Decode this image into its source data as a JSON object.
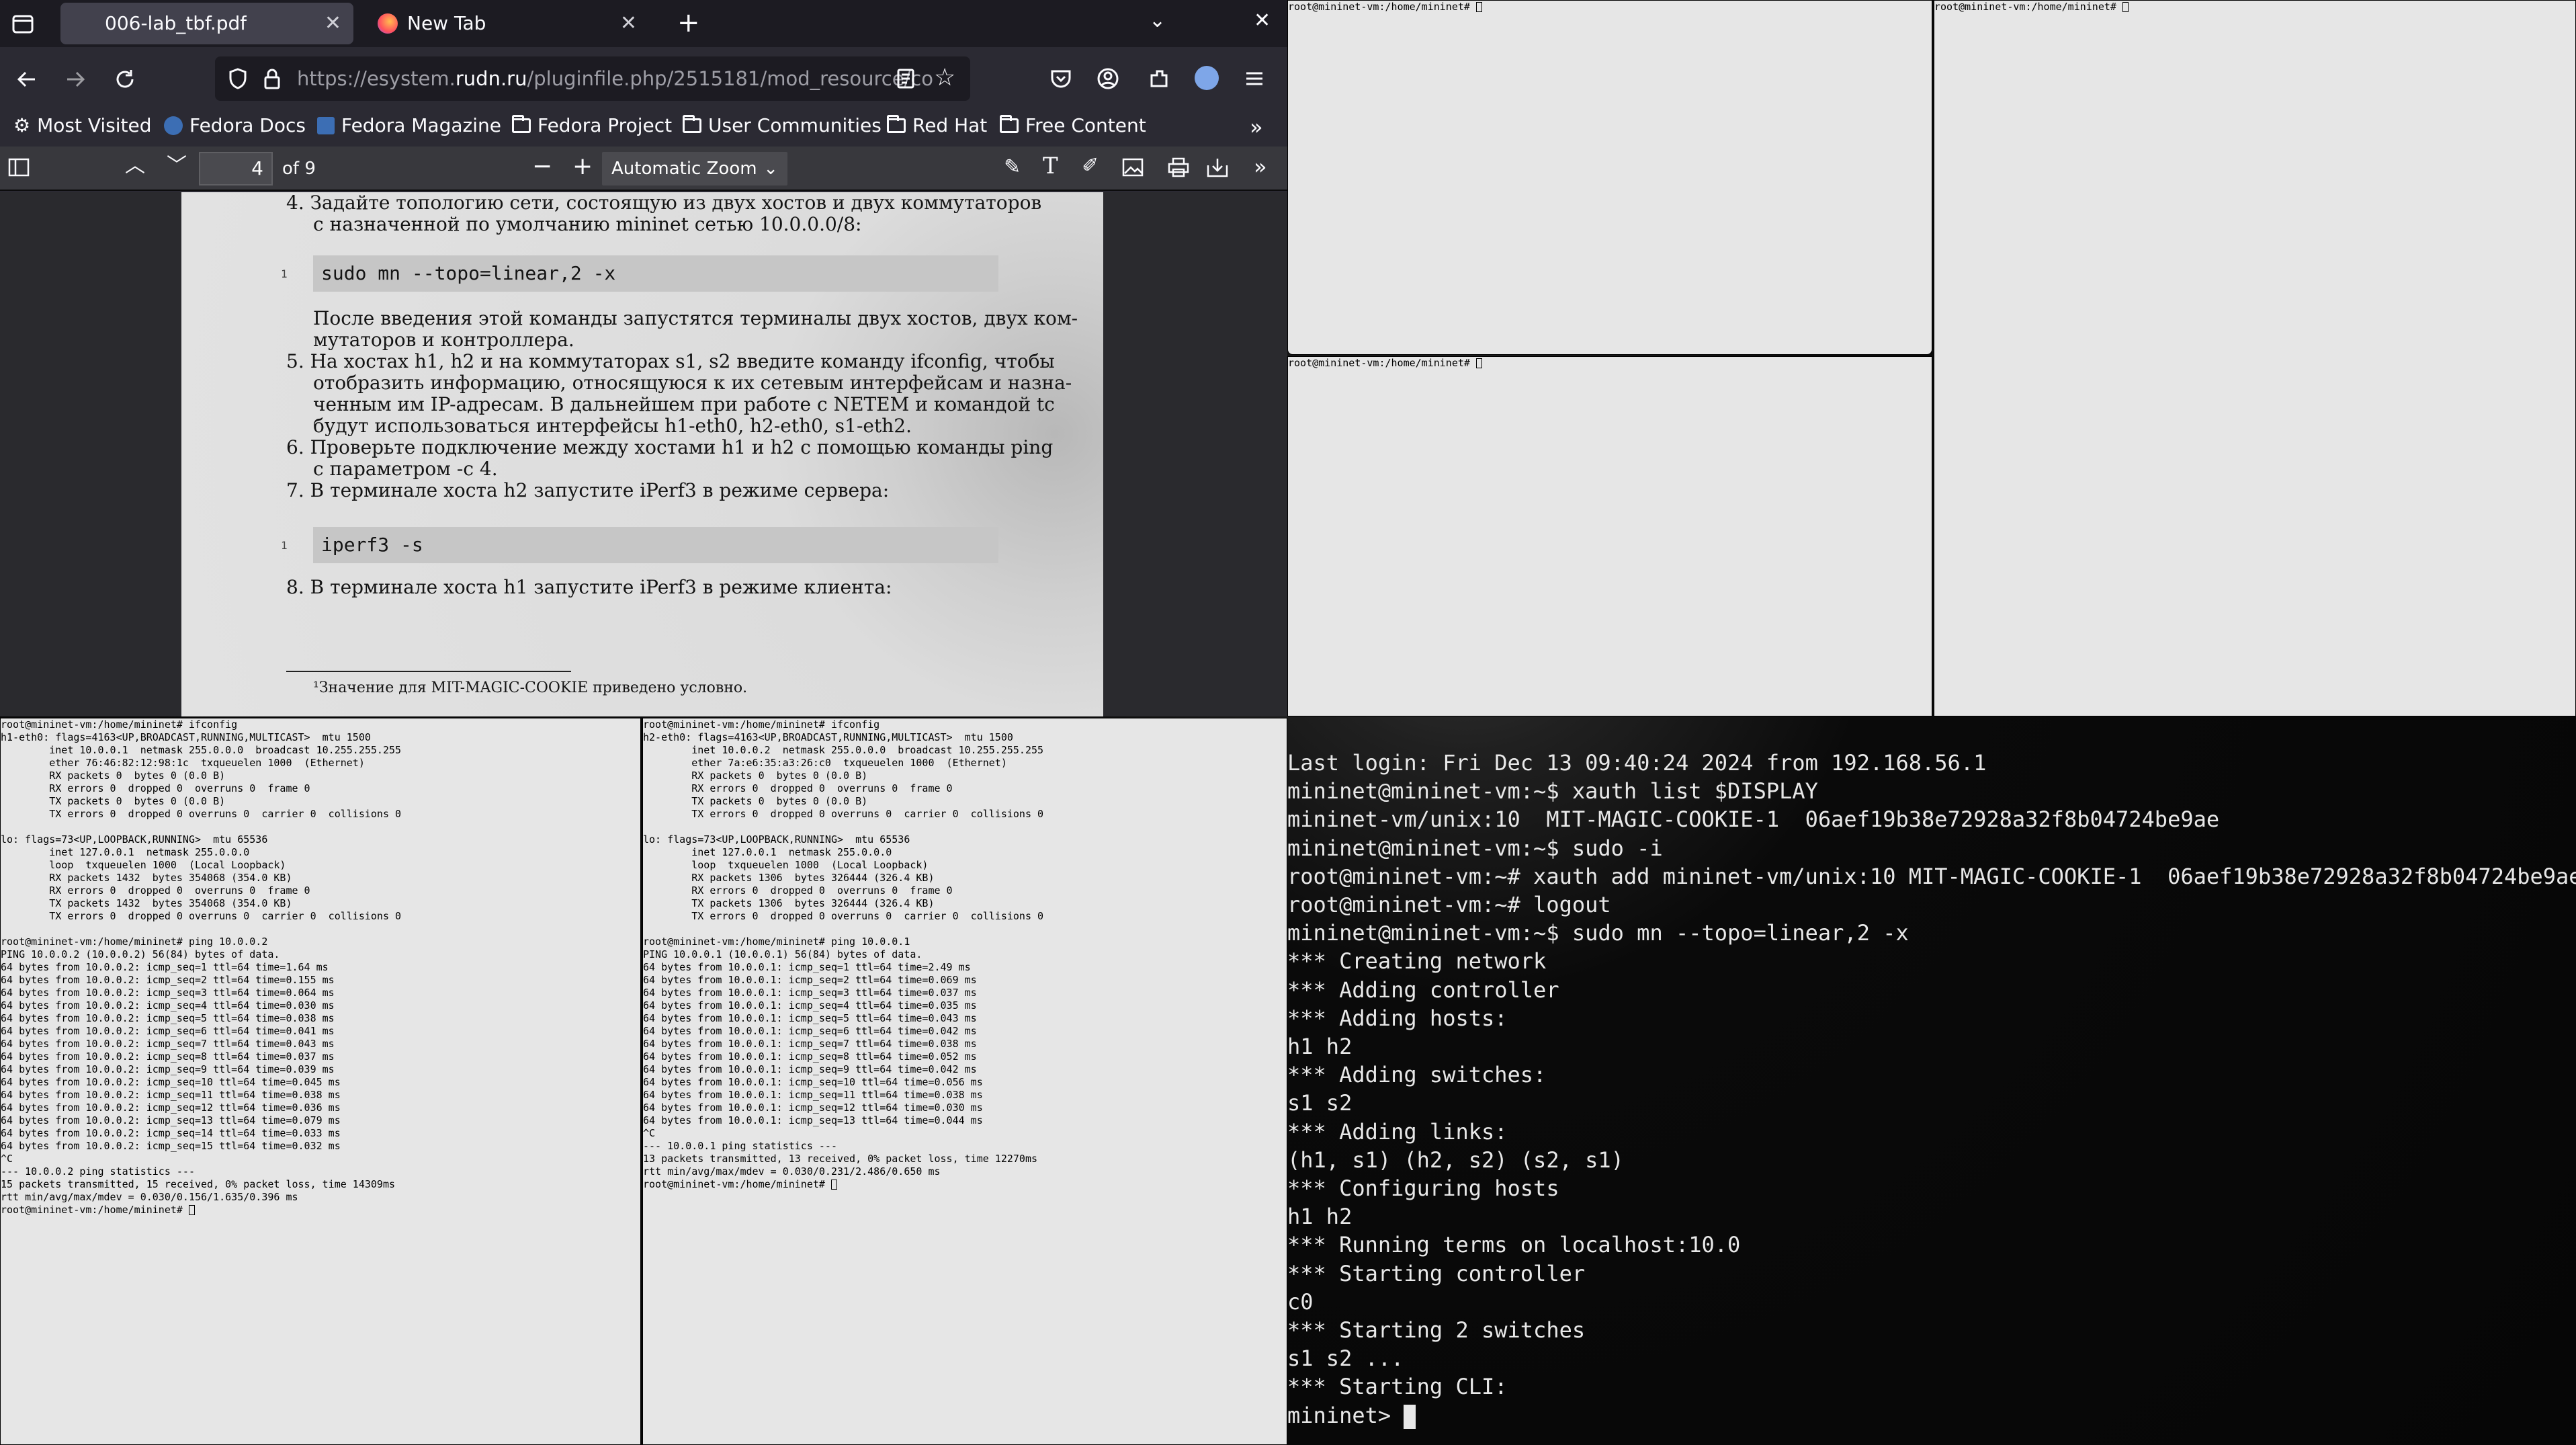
{
  "browser": {
    "tabs": [
      {
        "label": "006-lab_tbf.pdf",
        "active": true
      },
      {
        "label": "New Tab",
        "active": false
      }
    ],
    "new_tab": "+",
    "url_prefix": "https://esystem.",
    "url_domain": "rudn.ru",
    "url_rest": "/pluginfile.php/2515181/mod_resource/co",
    "bookmarks": [
      "Most Visited",
      "Fedora Docs",
      "Fedora Magazine",
      "Fedora Project",
      "User Communities",
      "Red Hat",
      "Free Content"
    ]
  },
  "pdf": {
    "page_number": "4",
    "page_total": "of 9",
    "zoom": "Automatic Zoom",
    "lines": {
      "l1": "4.  Задайте топологию сети, состоящую из двух хостов и двух коммутаторов",
      "l2": "с назначенной по умолчанию mininet сетью 10.0.0.0/8:",
      "code1": "sudo mn --topo=linear,2 -x",
      "code1_num": "1",
      "l3": "После введения этой команды запустятся терминалы двух хостов, двух ком-",
      "l4": "мутаторов и контроллера.",
      "l5": "5.  На хостах h1, h2 и на коммутаторах s1, s2 введите команду ifconfig, чтобы",
      "l6": "отобразить информацию, относящуюся к их сетевым интерфейсам и назна-",
      "l7": "ченным им IP-адресам. В дальнейшем при работе с NETEM и командой tc",
      "l8": "будут использоваться интерфейсы h1-eth0, h2-eth0, s1-eth2.",
      "l9": "6.  Проверьте подключение между хостами h1 и h2 с помощью команды ping",
      "l10": "с параметром -c 4.",
      "l11": "7.  В терминале хоста h2 запустите iPerf3 в режиме сервера:",
      "code2": "iperf3 -s",
      "code2_num": "1",
      "l12": "8.  В терминале хоста h1 запустите iPerf3 в режиме клиента:",
      "footnote": "¹Значение для MIT-MAGIC-COOKIE приведено условно."
    }
  },
  "xterms": {
    "top_left": "root@mininet-vm:/home/mininet# ",
    "top_right": "root@mininet-vm:/home/mininet# ",
    "mid_left": "root@mininet-vm:/home/mininet# ",
    "h1": "root@mininet-vm:/home/mininet# ifconfig\nh1-eth0: flags=4163<UP,BROADCAST,RUNNING,MULTICAST>  mtu 1500\n        inet 10.0.0.1  netmask 255.0.0.0  broadcast 10.255.255.255\n        ether 76:46:82:12:98:1c  txqueuelen 1000  (Ethernet)\n        RX packets 0  bytes 0 (0.0 B)\n        RX errors 0  dropped 0  overruns 0  frame 0\n        TX packets 0  bytes 0 (0.0 B)\n        TX errors 0  dropped 0 overruns 0  carrier 0  collisions 0\n\nlo: flags=73<UP,LOOPBACK,RUNNING>  mtu 65536\n        inet 127.0.0.1  netmask 255.0.0.0\n        loop  txqueuelen 1000  (Local Loopback)\n        RX packets 1432  bytes 354068 (354.0 KB)\n        RX errors 0  dropped 0  overruns 0  frame 0\n        TX packets 1432  bytes 354068 (354.0 KB)\n        TX errors 0  dropped 0 overruns 0  carrier 0  collisions 0\n\nroot@mininet-vm:/home/mininet# ping 10.0.0.2\nPING 10.0.0.2 (10.0.0.2) 56(84) bytes of data.\n64 bytes from 10.0.0.2: icmp_seq=1 ttl=64 time=1.64 ms\n64 bytes from 10.0.0.2: icmp_seq=2 ttl=64 time=0.155 ms\n64 bytes from 10.0.0.2: icmp_seq=3 ttl=64 time=0.064 ms\n64 bytes from 10.0.0.2: icmp_seq=4 ttl=64 time=0.030 ms\n64 bytes from 10.0.0.2: icmp_seq=5 ttl=64 time=0.038 ms\n64 bytes from 10.0.0.2: icmp_seq=6 ttl=64 time=0.041 ms\n64 bytes from 10.0.0.2: icmp_seq=7 ttl=64 time=0.043 ms\n64 bytes from 10.0.0.2: icmp_seq=8 ttl=64 time=0.037 ms\n64 bytes from 10.0.0.2: icmp_seq=9 ttl=64 time=0.039 ms\n64 bytes from 10.0.0.2: icmp_seq=10 ttl=64 time=0.045 ms\n64 bytes from 10.0.0.2: icmp_seq=11 ttl=64 time=0.038 ms\n64 bytes from 10.0.0.2: icmp_seq=12 ttl=64 time=0.036 ms\n64 bytes from 10.0.0.2: icmp_seq=13 ttl=64 time=0.079 ms\n64 bytes from 10.0.0.2: icmp_seq=14 ttl=64 time=0.033 ms\n64 bytes from 10.0.0.2: icmp_seq=15 ttl=64 time=0.032 ms\n^C\n--- 10.0.0.2 ping statistics ---\n15 packets transmitted, 15 received, 0% packet loss, time 14309ms\nrtt min/avg/max/mdev = 0.030/0.156/1.635/0.396 ms\nroot@mininet-vm:/home/mininet# ",
    "h2": "root@mininet-vm:/home/mininet# ifconfig\nh2-eth0: flags=4163<UP,BROADCAST,RUNNING,MULTICAST>  mtu 1500\n        inet 10.0.0.2  netmask 255.0.0.0  broadcast 10.255.255.255\n        ether 7a:e6:35:a3:26:c0  txqueuelen 1000  (Ethernet)\n        RX packets 0  bytes 0 (0.0 B)\n        RX errors 0  dropped 0  overruns 0  frame 0\n        TX packets 0  bytes 0 (0.0 B)\n        TX errors 0  dropped 0 overruns 0  carrier 0  collisions 0\n\nlo: flags=73<UP,LOOPBACK,RUNNING>  mtu 65536\n        inet 127.0.0.1  netmask 255.0.0.0\n        loop  txqueuelen 1000  (Local Loopback)\n        RX packets 1306  bytes 326444 (326.4 KB)\n        RX errors 0  dropped 0  overruns 0  frame 0\n        TX packets 1306  bytes 326444 (326.4 KB)\n        TX errors 0  dropped 0 overruns 0  carrier 0  collisions 0\n\nroot@mininet-vm:/home/mininet# ping 10.0.0.1\nPING 10.0.0.1 (10.0.0.1) 56(84) bytes of data.\n64 bytes from 10.0.0.1: icmp_seq=1 ttl=64 time=2.49 ms\n64 bytes from 10.0.0.1: icmp_seq=2 ttl=64 time=0.069 ms\n64 bytes from 10.0.0.1: icmp_seq=3 ttl=64 time=0.037 ms\n64 bytes from 10.0.0.1: icmp_seq=4 ttl=64 time=0.035 ms\n64 bytes from 10.0.0.1: icmp_seq=5 ttl=64 time=0.043 ms\n64 bytes from 10.0.0.1: icmp_seq=6 ttl=64 time=0.042 ms\n64 bytes from 10.0.0.1: icmp_seq=7 ttl=64 time=0.038 ms\n64 bytes from 10.0.0.1: icmp_seq=8 ttl=64 time=0.052 ms\n64 bytes from 10.0.0.1: icmp_seq=9 ttl=64 time=0.042 ms\n64 bytes from 10.0.0.1: icmp_seq=10 ttl=64 time=0.056 ms\n64 bytes from 10.0.0.1: icmp_seq=11 ttl=64 time=0.038 ms\n64 bytes from 10.0.0.1: icmp_seq=12 ttl=64 time=0.030 ms\n64 bytes from 10.0.0.1: icmp_seq=13 ttl=64 time=0.044 ms\n^C\n--- 10.0.0.1 ping statistics ---\n13 packets transmitted, 13 received, 0% packet loss, time 12270ms\nrtt min/avg/max/mdev = 0.030/0.231/2.486/0.650 ms\nroot@mininet-vm:/home/mininet# "
  },
  "main_terminal": {
    "text": "Last login: Fri Dec 13 09:40:24 2024 from 192.168.56.1\nmininet@mininet-vm:~$ xauth list $DISPLAY\nmininet-vm/unix:10  MIT-MAGIC-COOKIE-1  06aef19b38e72928a32f8b04724be9ae\nmininet@mininet-vm:~$ sudo -i\nroot@mininet-vm:~# xauth add mininet-vm/unix:10 MIT-MAGIC-COOKIE-1  06aef19b38e72928a32f8b04724be9ae\nroot@mininet-vm:~# logout\nmininet@mininet-vm:~$ sudo mn --topo=linear,2 -x\n*** Creating network\n*** Adding controller\n*** Adding hosts:\nh1 h2\n*** Adding switches:\ns1 s2\n*** Adding links:\n(h1, s1) (h2, s2) (s2, s1)\n*** Configuring hosts\nh1 h2\n*** Running terms on localhost:10.0\n*** Starting controller\nc0\n*** Starting 2 switches\ns1 s2 ...\n*** Starting CLI:\nmininet> "
  }
}
